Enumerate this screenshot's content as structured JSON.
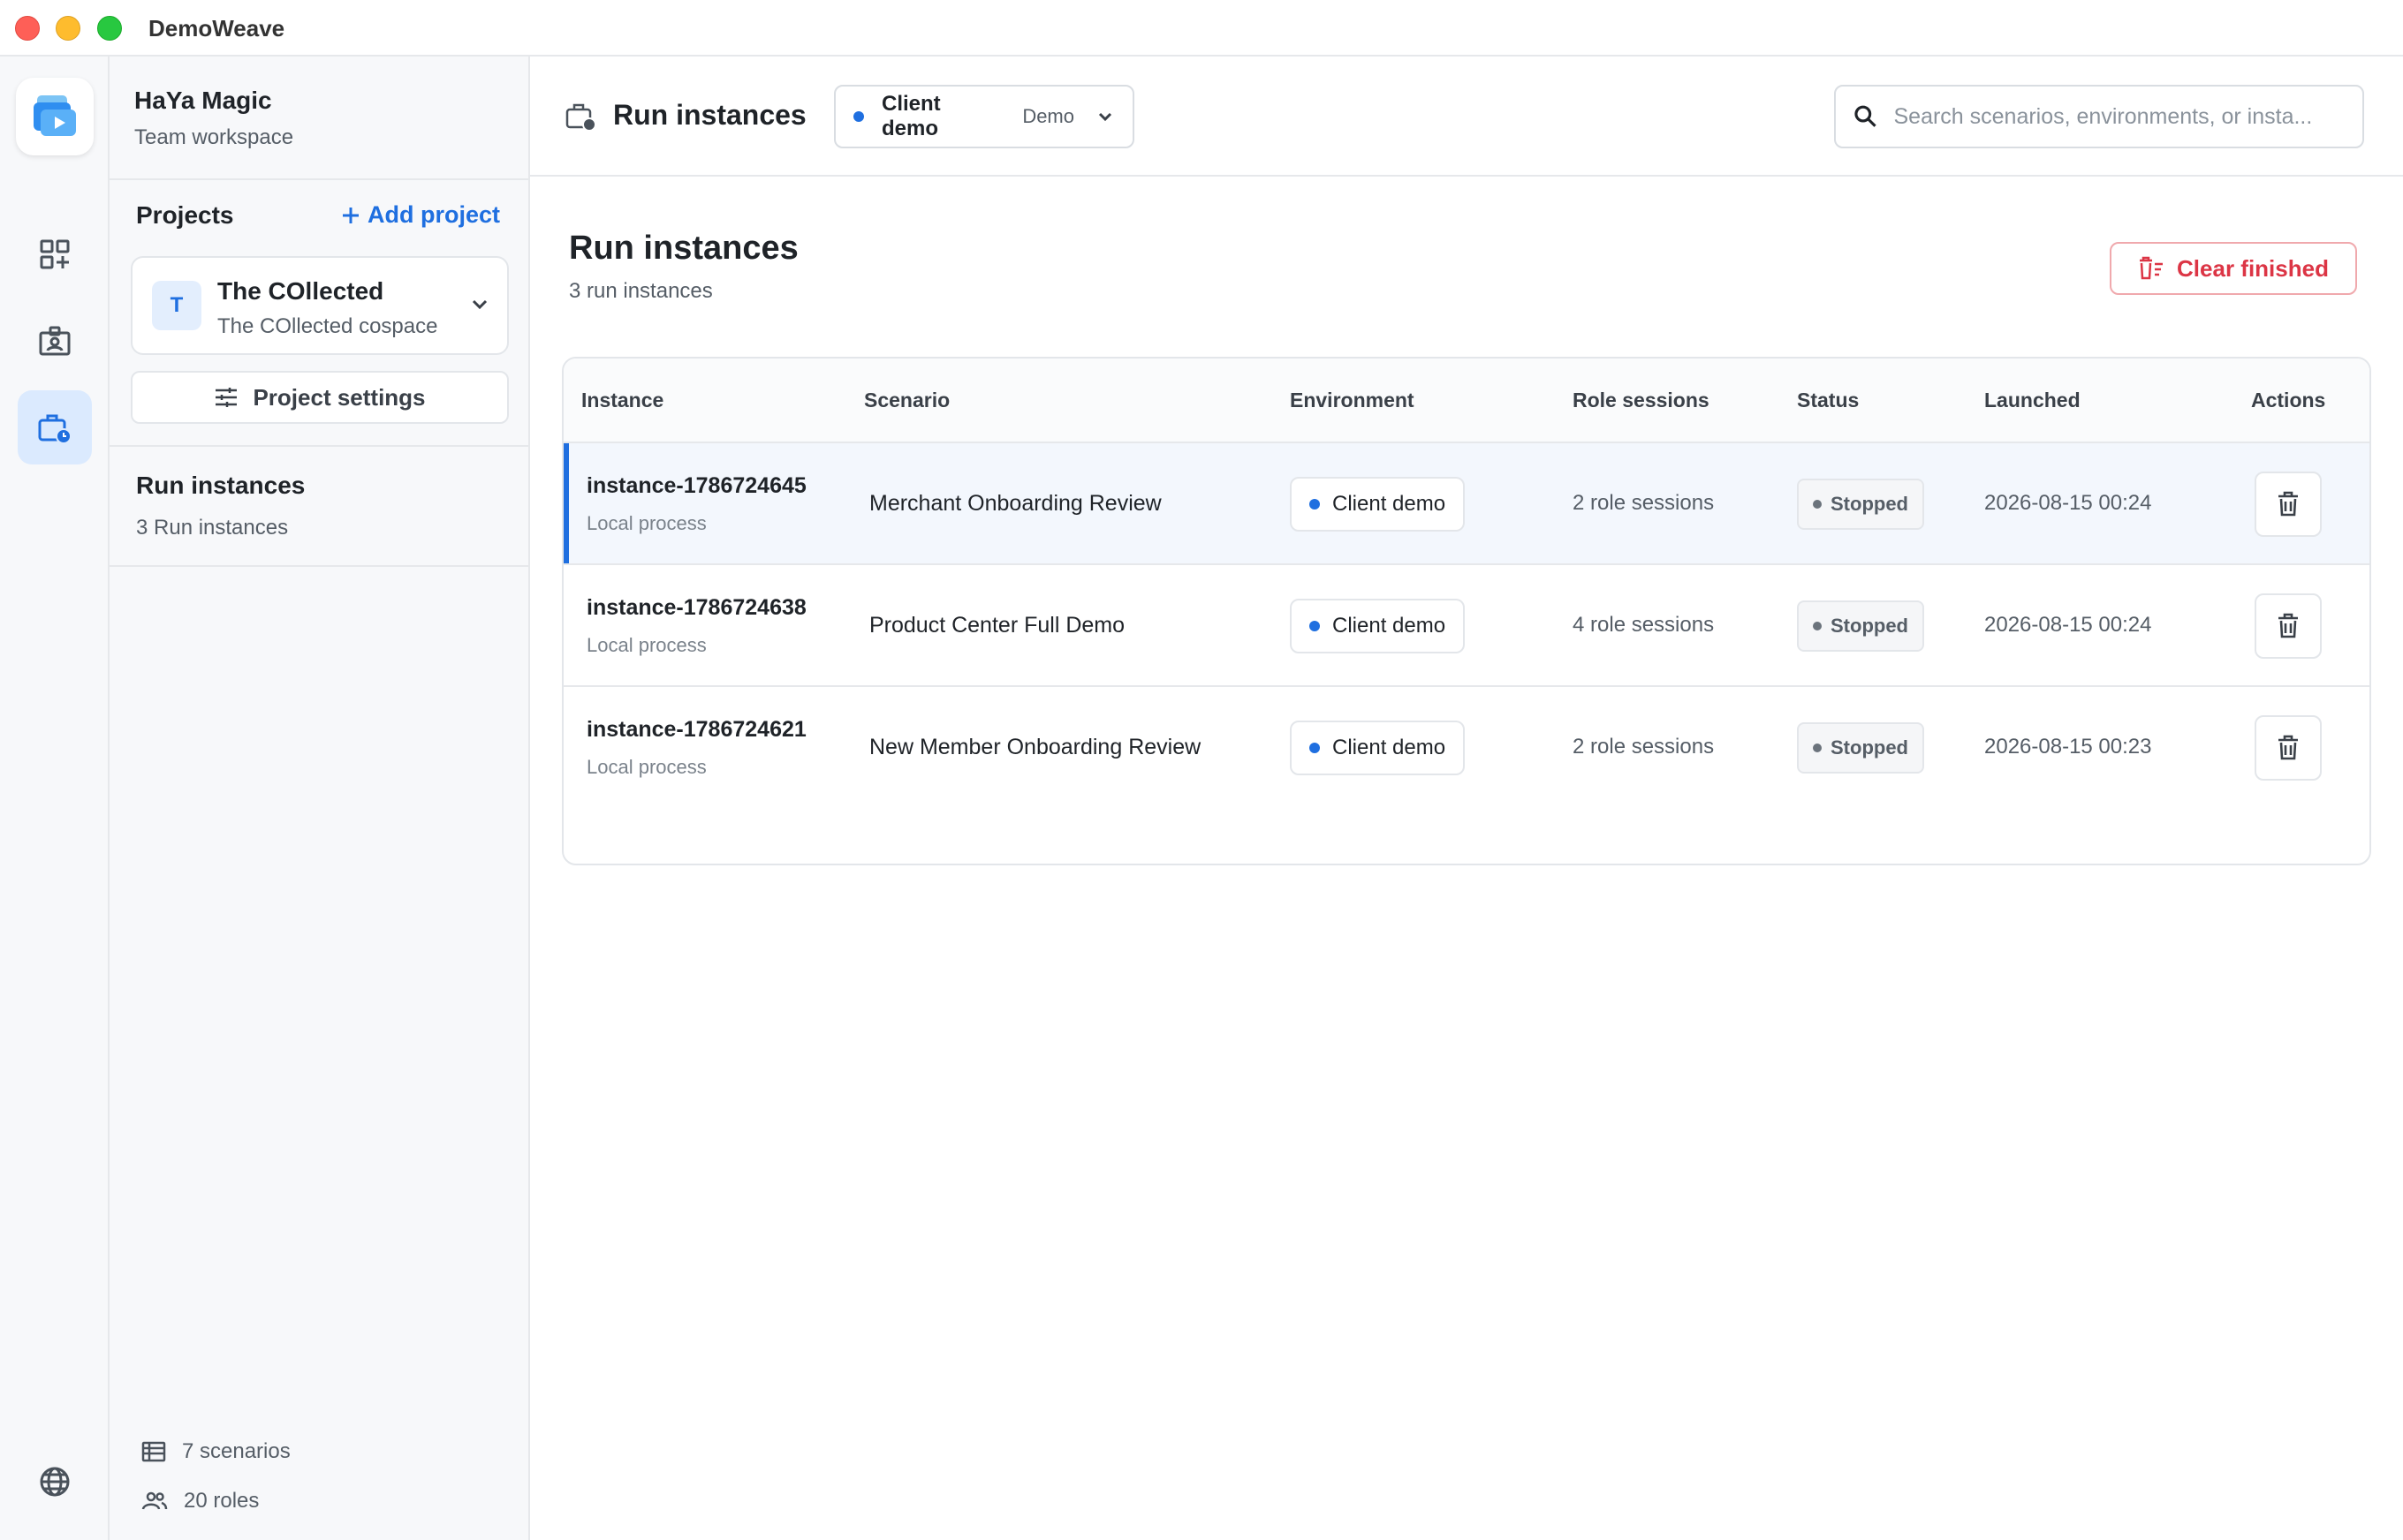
{
  "app": {
    "title": "DemoWeave"
  },
  "colors": {
    "accent": "#1f6fe0",
    "danger": "#dc3545",
    "status_stopped": "#6b737c"
  },
  "rail": {
    "icons": [
      "app-logo-icon",
      "dashboard-add-icon",
      "role-badge-icon",
      "run-instances-icon",
      "language-globe-icon"
    ]
  },
  "workspace": {
    "name": "HaYa Magic",
    "subtitle": "Team workspace"
  },
  "projects": {
    "heading": "Projects",
    "add_label": "Add project",
    "current": {
      "avatar": "T",
      "name": "The COllected",
      "subtitle": "The COllected cospace"
    },
    "settings_label": "Project settings"
  },
  "nav": {
    "title": "Run instances",
    "subtitle": "3 Run instances"
  },
  "sidebar_stats": {
    "scenarios": "7 scenarios",
    "roles": "20 roles"
  },
  "topbar": {
    "title": "Run instances",
    "environment": {
      "name": "Client demo",
      "tag": "Demo"
    },
    "search": {
      "placeholder": "Search scenarios, environments, or insta...",
      "value": ""
    }
  },
  "page": {
    "title": "Run instances",
    "subtitle": "3 run instances",
    "clear_label": "Clear finished"
  },
  "table": {
    "columns": [
      "Instance",
      "Scenario",
      "Environment",
      "Role sessions",
      "Status",
      "Launched",
      "Actions"
    ],
    "rows": [
      {
        "instance": "instance-1786724645",
        "instance_type": "Local process",
        "scenario": "Merchant Onboarding Review",
        "environment": "Client demo",
        "role_sessions": "2 role sessions",
        "status": "Stopped",
        "launched": "2026-08-15 00:24",
        "selected": true
      },
      {
        "instance": "instance-1786724638",
        "instance_type": "Local process",
        "scenario": "Product Center Full Demo",
        "environment": "Client demo",
        "role_sessions": "4 role sessions",
        "status": "Stopped",
        "launched": "2026-08-15 00:24",
        "selected": false
      },
      {
        "instance": "instance-1786724621",
        "instance_type": "Local process",
        "scenario": "New Member Onboarding Review",
        "environment": "Client demo",
        "role_sessions": "2 role sessions",
        "status": "Stopped",
        "launched": "2026-08-15 00:23",
        "selected": false
      }
    ]
  }
}
